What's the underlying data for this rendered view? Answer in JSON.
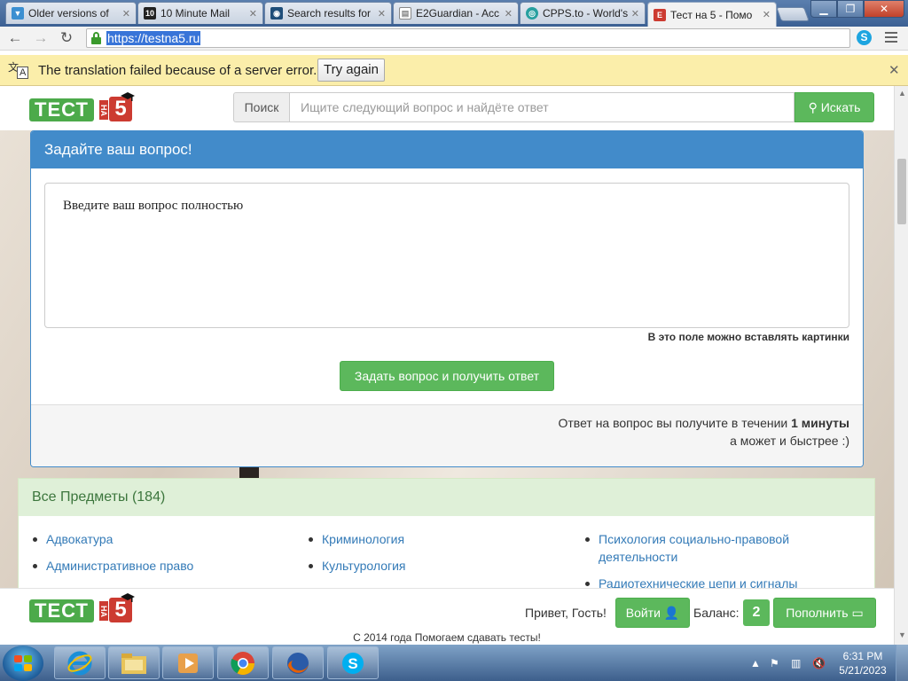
{
  "browser": {
    "tabs": [
      {
        "label": "Older versions of",
        "favicon": "download-icon",
        "color": "#3b8fd1"
      },
      {
        "label": "10 Minute Mail",
        "favicon": "10mm-icon",
        "color": "#222222"
      },
      {
        "label": "Search results for",
        "favicon": "site-icon",
        "color": "#1f4e79"
      },
      {
        "label": "E2Guardian - Acc",
        "favicon": "page-icon",
        "color": "#888888"
      },
      {
        "label": "CPPS.to - World's",
        "favicon": "cpps-icon",
        "color": "#28a0a0"
      },
      {
        "label": "Тест на 5 - Помо",
        "favicon": "testna5-icon",
        "color": "#cc3b31"
      }
    ],
    "url": "https://testna5.ru"
  },
  "infobar": {
    "message": "The translation failed because of a server error.",
    "retry_label": "Try again"
  },
  "site": {
    "logo_text": "ТЕСТ",
    "logo_na": "НА",
    "logo_five": "5",
    "search_label": "Поиск",
    "search_placeholder": "Ищите следующий вопрос и найдёте ответ",
    "search_button": "Искать",
    "ask_panel": {
      "title": "Задайте ваш вопрос!",
      "placeholder": "Введите ваш вопрос полностью",
      "hint": "В это поле можно вставлять картинки",
      "submit": "Задать вопрос и получить ответ",
      "answer_prefix": "Ответ на вопрос вы получите в течении",
      "answer_time": "1 минуты",
      "answer_line2": "а может и быстрее :)"
    },
    "subjects": {
      "title": "Все Предметы (184)",
      "columns": [
        [
          "Адвокатура",
          "Административное право"
        ],
        [
          "Криминология",
          "Культурология"
        ],
        [
          "Психология социально-правовой деятельности",
          "Радиотехнические цепи и сигналы"
        ]
      ]
    },
    "footer": {
      "greeting": "Привет, Гость!",
      "login": "Войти",
      "balance_label": "Баланс:",
      "balance_value": "2",
      "topup": "Пополнить",
      "copyright": "С 2014 года Помогаем сдавать тесты!"
    }
  },
  "taskbar": {
    "apps": [
      "ie-icon",
      "explorer-icon",
      "media-player-icon",
      "chrome-icon",
      "firefox-icon",
      "skype-icon"
    ],
    "time": "6:31 PM",
    "date": "5/21/2023"
  },
  "colors": {
    "brand_green": "#5cb85c",
    "panel_blue": "#428bca",
    "logo_red": "#cc3b31",
    "infobar_yellow": "#fbeeaa"
  }
}
